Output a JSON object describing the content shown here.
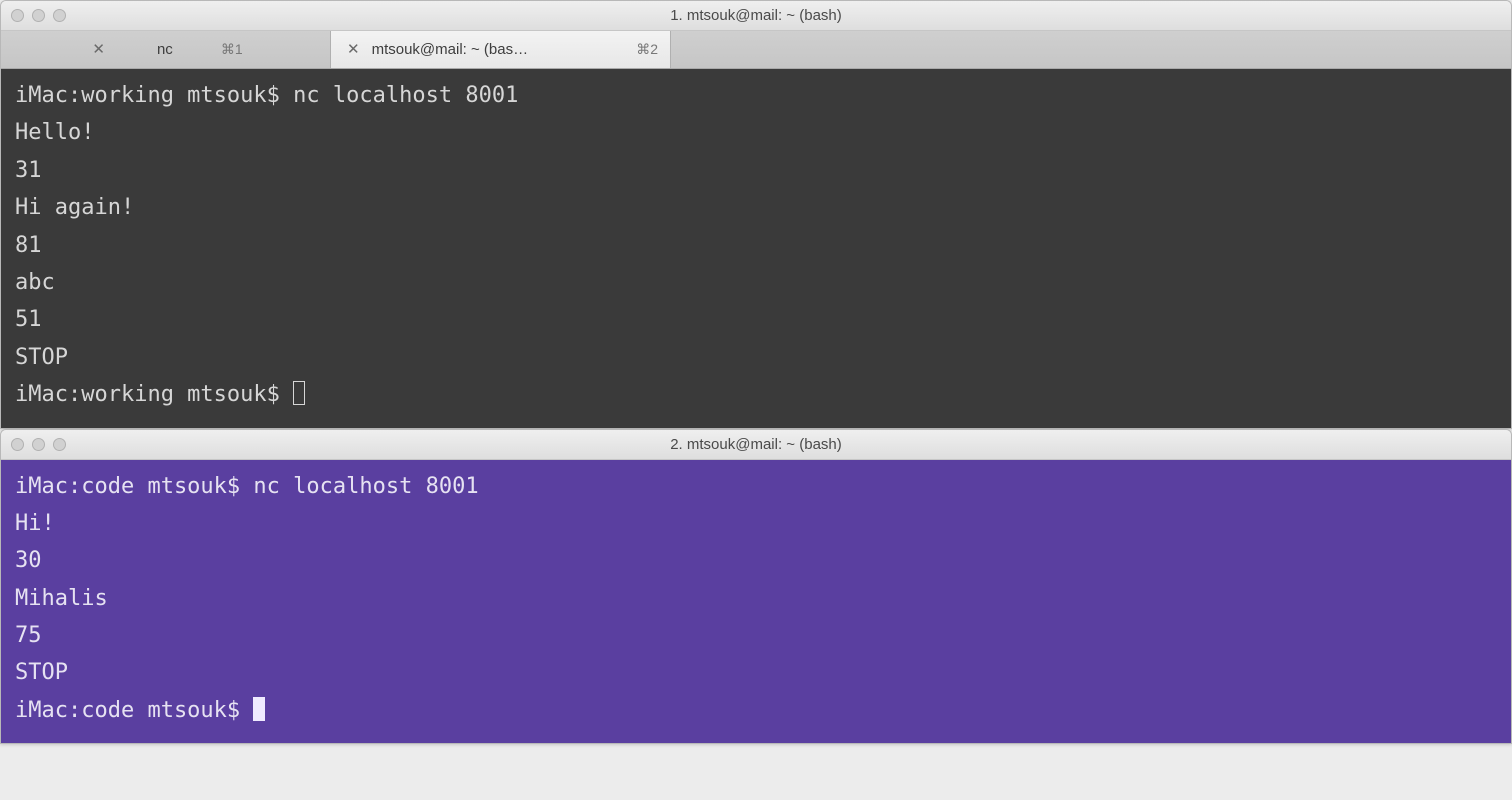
{
  "window1": {
    "title": "1. mtsouk@mail: ~ (bash)",
    "tabs": [
      {
        "label": "nc",
        "shortcut": "⌘1"
      },
      {
        "label": "mtsouk@mail: ~ (bas…",
        "shortcut": "⌘2"
      }
    ],
    "terminal": {
      "prompt1": "iMac:working mtsouk$ nc localhost 8001",
      "lines": [
        "Hello!",
        "31",
        "Hi again!",
        "81",
        "abc",
        "51",
        "STOP"
      ],
      "prompt2": "iMac:working mtsouk$ "
    }
  },
  "window2": {
    "title": "2. mtsouk@mail: ~ (bash)",
    "terminal": {
      "prompt1": "iMac:code mtsouk$ nc localhost 8001",
      "lines": [
        "Hi!",
        "30",
        "Mihalis",
        "75",
        "STOP"
      ],
      "prompt2": "iMac:code mtsouk$ "
    }
  }
}
